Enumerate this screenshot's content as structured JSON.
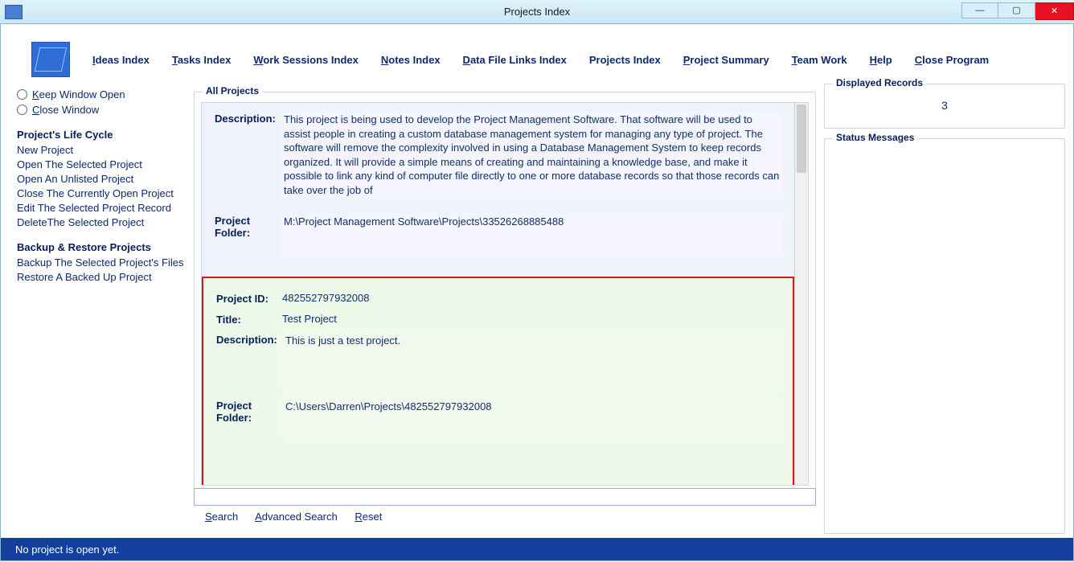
{
  "window": {
    "title": "Projects Index"
  },
  "menu": [
    {
      "label": "Ideas Index",
      "ul": "I",
      "rest": "deas Index"
    },
    {
      "label": "Tasks Index",
      "ul": "T",
      "rest": "asks Index"
    },
    {
      "label": "Work Sessions Index",
      "ul": "W",
      "rest": "ork Sessions Index"
    },
    {
      "label": "Notes Index",
      "ul": "N",
      "rest": "otes Index"
    },
    {
      "label": "Data File Links Index",
      "ul": "D",
      "rest": "ata File Links Index"
    },
    {
      "label": "Projects Index",
      "ul": "",
      "rest": "Projects Index"
    },
    {
      "label": "Project Summary",
      "ul": "P",
      "rest": "roject Summary"
    },
    {
      "label": "Team Work",
      "ul": "T",
      "rest": "eam Work"
    },
    {
      "label": "Help",
      "ul": "H",
      "rest": "elp"
    },
    {
      "label": "Close Program",
      "ul": "C",
      "rest": "lose Program"
    }
  ],
  "sidebar": {
    "radios": {
      "keep": {
        "ul": "K",
        "rest": "eep Window Open"
      },
      "close": {
        "ul": "C",
        "rest": "lose Window"
      }
    },
    "lifecycle_header": "Project's Life Cycle",
    "lifecycle": [
      "New Project",
      "Open The Selected Project",
      "Open An Unlisted Project",
      "Close The Currently Open Project",
      "Edit The Selected Project Record",
      "DeleteThe Selected Project"
    ],
    "backup_header": "Backup & Restore Projects",
    "backup": [
      "Backup The Selected Project's Files",
      "Restore A Backed Up Project"
    ]
  },
  "all_projects_legend": "All Projects",
  "labels": {
    "description": "Description:",
    "project_folder": "Project Folder:",
    "project_id": "Project ID:",
    "title": "Title:"
  },
  "projects": [
    {
      "description": "This project is being used to develop the Project Management Software. That software will be used to assist people in creating a custom database management system for managing any type of project. The software will remove the complexity involved in using a Database Management System to keep records organized. It will provide a simple means of creating and maintaining a knowledge base, and make it possible to link any kind of computer file directly to one or more database records so that those records can take over the job of",
      "folder": "M:\\Project Management Software\\Projects\\33526268885488"
    },
    {
      "project_id": "482552797932008",
      "title": "Test Project",
      "description": "This is just a test project.",
      "folder": "C:\\Users\\Darren\\Projects\\482552797932008",
      "selected": true
    }
  ],
  "search": {
    "links": {
      "search": {
        "ul": "S",
        "rest": "earch"
      },
      "advanced": {
        "ul": "A",
        "rest": "dvanced Search"
      },
      "reset": {
        "ul": "R",
        "rest": "eset"
      }
    }
  },
  "right": {
    "displayed_records_legend": "Displayed Records",
    "displayed_records_value": "3",
    "status_messages_legend": "Status Messages"
  },
  "statusbar": "No project is open yet."
}
